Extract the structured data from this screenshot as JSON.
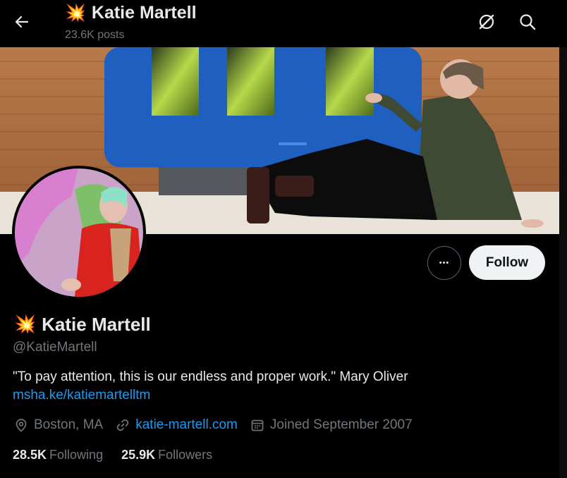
{
  "header": {
    "emoji": "💥",
    "name": "Katie Martell",
    "posts": "23.6K posts",
    "icons": [
      "back-arrow-icon",
      "grok-icon",
      "search-icon"
    ]
  },
  "actions": {
    "more_label": "•••",
    "follow_label": "Follow"
  },
  "profile": {
    "emoji": "💥",
    "name": "Katie Martell",
    "handle": "@KatieMartell",
    "bio": "\"To pay attention, this is our endless and proper work.\" Mary Oliver",
    "bio_link": "msha.ke/katiemartelltm",
    "location": "Boston, MA",
    "website": "katie-martell.com",
    "joined": "Joined September 2007"
  },
  "stats": {
    "following_count": "28.5K",
    "following_label": "Following",
    "followers_count": "25.9K",
    "followers_label": "Followers"
  },
  "colors": {
    "background": "#000000",
    "text_primary": "#e7e9ea",
    "text_secondary": "#71767b",
    "link": "#1d9bf0",
    "follow_button": "#eff3f4"
  }
}
